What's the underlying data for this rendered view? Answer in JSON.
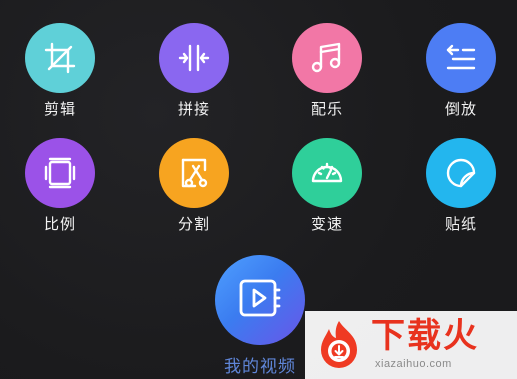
{
  "tools": [
    {
      "key": "crop",
      "label": "剪辑",
      "icon": "crop-icon",
      "color": "#5fd0d8"
    },
    {
      "key": "merge",
      "label": "拼接",
      "icon": "merge-icon",
      "color": "#8a67f0"
    },
    {
      "key": "music",
      "label": "配乐",
      "icon": "music-note-icon",
      "color": "#f277a6"
    },
    {
      "key": "reverse",
      "label": "倒放",
      "icon": "reverse-list-icon",
      "color": "#4d7df4"
    },
    {
      "key": "ratio",
      "label": "比例",
      "icon": "aspect-ratio-icon",
      "color": "#9b52e8"
    },
    {
      "key": "split",
      "label": "分割",
      "icon": "split-scissors-icon",
      "color": "#f7a420"
    },
    {
      "key": "speed",
      "label": "变速",
      "icon": "speedometer-icon",
      "color": "#2fcf9a"
    },
    {
      "key": "sticker",
      "label": "贴纸",
      "icon": "sticker-icon",
      "color": "#23b6ee"
    }
  ],
  "my_video": {
    "label": "我的视频",
    "icon": "video-play-icon"
  },
  "watermark": {
    "title": "下载火",
    "url": "xiazaihuo.com"
  }
}
